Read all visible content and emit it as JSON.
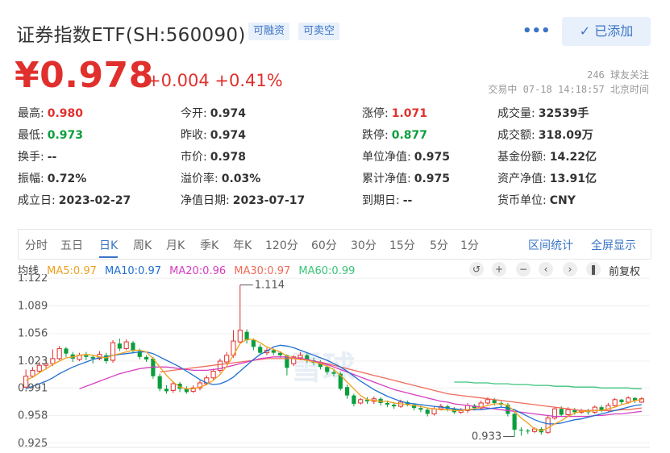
{
  "header": {
    "title": "证券指数ETF(SH:560090)",
    "tag1": "可融资",
    "tag2": "可卖空",
    "more": "•••",
    "added_label": "已添加"
  },
  "quote": {
    "price": "¥0.978",
    "change": "+0.004  +0.41%",
    "followers": "246 球友关注",
    "status": "交易中 07-18 14:18:57 北京时间"
  },
  "stats": [
    {
      "label": "最高:",
      "value": "0.980",
      "color": "red"
    },
    {
      "label": "今开:",
      "value": "0.974",
      "color": ""
    },
    {
      "label": "涨停:",
      "value": "1.071",
      "color": "red"
    },
    {
      "label": "成交量:",
      "value": "32539手",
      "color": ""
    },
    {
      "label": "最低:",
      "value": "0.973",
      "color": "green"
    },
    {
      "label": "昨收:",
      "value": "0.974",
      "color": ""
    },
    {
      "label": "跌停:",
      "value": "0.877",
      "color": "green"
    },
    {
      "label": "成交额:",
      "value": "318.09万",
      "color": ""
    },
    {
      "label": "换手:",
      "value": "--",
      "color": ""
    },
    {
      "label": "市价:",
      "value": "0.978",
      "color": ""
    },
    {
      "label": "单位净值:",
      "value": "0.975",
      "color": ""
    },
    {
      "label": "基金份额:",
      "value": "14.22亿",
      "color": ""
    },
    {
      "label": "振幅:",
      "value": "0.72%",
      "color": ""
    },
    {
      "label": "溢价率:",
      "value": "0.03%",
      "color": ""
    },
    {
      "label": "累计净值:",
      "value": "0.975",
      "color": ""
    },
    {
      "label": "资产净值:",
      "value": "13.91亿",
      "color": ""
    },
    {
      "label": "成立日:",
      "value": "2023-02-27",
      "color": ""
    },
    {
      "label": "净值日期:",
      "value": "2023-07-17",
      "color": ""
    },
    {
      "label": "到期日:",
      "value": "--",
      "color": ""
    },
    {
      "label": "货币单位:",
      "value": "CNY",
      "color": ""
    }
  ],
  "tabs": [
    "分时",
    "五日",
    "日K",
    "周K",
    "月K",
    "季K",
    "年K",
    "120分",
    "60分",
    "30分",
    "15分",
    "5分",
    "1分"
  ],
  "active_tab": 2,
  "tab_links": {
    "interval": "区间统计",
    "fullscreen": "全屏显示"
  },
  "ma": {
    "label": "均线",
    "ma5": "MA5:0.97",
    "ma10": "MA10:0.97",
    "ma20": "MA20:0.96",
    "ma30": "MA30:0.97",
    "ma60": "MA60:0.99"
  },
  "controls": {
    "reset": "↺",
    "zoom_in": "+",
    "zoom_out": "−",
    "prev": "‹",
    "next": "›",
    "pause": "❚",
    "adjust": "前复权"
  },
  "watermark": "雪球",
  "colors": {
    "up": "#e0302d",
    "down": "#0a9e3c",
    "ma5": "#f0a01e",
    "ma10": "#1f6fd1",
    "ma20": "#d63cc2",
    "ma30": "#f06b5a",
    "ma60": "#3cc47a"
  },
  "chart_data": {
    "type": "candlestick",
    "y_ticks": [
      "1.122",
      "1.089",
      "1.056",
      "1.023",
      "0.991",
      "0.958",
      "0.925"
    ],
    "ylim": [
      0.92,
      1.127
    ],
    "annotations": {
      "high": "1.114",
      "low": "0.933"
    },
    "candles": [
      [
        1.005,
        0.992,
        1.013,
        0.99
      ],
      [
        1.012,
        1.005,
        1.016,
        1.003
      ],
      [
        1.018,
        1.011,
        1.022,
        1.009
      ],
      [
        1.02,
        1.018,
        1.026,
        1.013
      ],
      [
        1.026,
        1.02,
        1.037,
        1.017
      ],
      [
        1.038,
        1.026,
        1.041,
        1.024
      ],
      [
        1.032,
        1.038,
        1.04,
        1.028
      ],
      [
        1.026,
        1.031,
        1.034,
        1.022
      ],
      [
        1.03,
        1.025,
        1.033,
        1.023
      ],
      [
        1.028,
        1.03,
        1.034,
        1.024
      ],
      [
        1.026,
        1.028,
        1.03,
        1.02
      ],
      [
        1.031,
        1.026,
        1.035,
        1.024
      ],
      [
        1.023,
        1.03,
        1.033,
        1.02
      ],
      [
        1.045,
        1.024,
        1.048,
        1.021
      ],
      [
        1.038,
        1.044,
        1.05,
        1.035
      ],
      [
        1.046,
        1.038,
        1.049,
        1.036
      ],
      [
        1.035,
        1.045,
        1.047,
        1.032
      ],
      [
        1.028,
        1.035,
        1.038,
        1.025
      ],
      [
        1.025,
        1.028,
        1.03,
        1.022
      ],
      [
        1.005,
        1.026,
        1.028,
        1.002
      ],
      [
        0.99,
        1.005,
        1.008,
        0.987
      ],
      [
        0.987,
        0.99,
        0.994,
        0.984
      ],
      [
        0.996,
        0.988,
        0.999,
        0.985
      ],
      [
        0.99,
        0.996,
        0.998,
        0.986
      ],
      [
        0.986,
        0.99,
        0.993,
        0.984
      ],
      [
        0.991,
        0.987,
        0.994,
        0.985
      ],
      [
        0.997,
        0.991,
        1.0,
        0.988
      ],
      [
        1.003,
        0.996,
        1.006,
        0.994
      ],
      [
        1.011,
        1.003,
        1.014,
        1.001
      ],
      [
        1.023,
        1.012,
        1.026,
        1.009
      ],
      [
        1.03,
        1.022,
        1.034,
        1.019
      ],
      [
        1.047,
        1.03,
        1.06,
        1.027
      ],
      [
        1.06,
        1.046,
        1.114,
        1.044
      ],
      [
        1.048,
        1.058,
        1.061,
        1.044
      ],
      [
        1.04,
        1.048,
        1.05,
        1.036
      ],
      [
        1.033,
        1.04,
        1.043,
        1.03
      ],
      [
        1.036,
        1.033,
        1.039,
        1.03
      ],
      [
        1.033,
        1.036,
        1.038,
        1.03
      ],
      [
        1.03,
        1.033,
        1.035,
        1.027
      ],
      [
        1.015,
        1.03,
        1.031,
        1.006
      ],
      [
        1.028,
        1.02,
        1.03,
        1.017
      ],
      [
        1.03,
        1.027,
        1.034,
        1.024
      ],
      [
        1.024,
        1.03,
        1.032,
        1.021
      ],
      [
        1.021,
        1.024,
        1.027,
        1.018
      ],
      [
        1.016,
        1.021,
        1.024,
        1.013
      ],
      [
        1.01,
        1.016,
        1.018,
        1.007
      ],
      [
        1.008,
        1.01,
        1.014,
        1.005
      ],
      [
        0.99,
        1.008,
        1.01,
        0.988
      ],
      [
        0.982,
        0.992,
        0.995,
        0.978
      ],
      [
        0.972,
        0.982,
        0.984,
        0.969
      ],
      [
        0.977,
        0.973,
        0.979,
        0.971
      ],
      [
        0.975,
        0.977,
        0.98,
        0.972
      ],
      [
        0.978,
        0.975,
        0.981,
        0.972
      ],
      [
        0.973,
        0.978,
        0.98,
        0.97
      ],
      [
        0.971,
        0.973,
        0.976,
        0.968
      ],
      [
        0.969,
        0.971,
        0.974,
        0.966
      ],
      [
        0.974,
        0.969,
        0.977,
        0.967
      ],
      [
        0.971,
        0.974,
        0.976,
        0.969
      ],
      [
        0.967,
        0.971,
        0.973,
        0.964
      ],
      [
        0.965,
        0.967,
        0.97,
        0.962
      ],
      [
        0.96,
        0.965,
        0.967,
        0.957
      ],
      [
        0.966,
        0.96,
        0.969,
        0.958
      ],
      [
        0.969,
        0.966,
        0.972,
        0.964
      ],
      [
        0.966,
        0.969,
        0.971,
        0.963
      ],
      [
        0.962,
        0.966,
        0.968,
        0.96
      ],
      [
        0.964,
        0.962,
        0.967,
        0.96
      ],
      [
        0.97,
        0.964,
        0.973,
        0.961
      ],
      [
        0.967,
        0.97,
        0.972,
        0.964
      ],
      [
        0.973,
        0.967,
        0.976,
        0.965
      ],
      [
        0.977,
        0.973,
        0.98,
        0.971
      ],
      [
        0.973,
        0.977,
        0.979,
        0.97
      ],
      [
        0.971,
        0.973,
        0.975,
        0.968
      ],
      [
        0.96,
        0.971,
        0.973,
        0.957
      ],
      [
        0.941,
        0.96,
        0.962,
        0.933
      ],
      [
        0.94,
        0.941,
        0.944,
        0.934
      ],
      [
        0.939,
        0.94,
        0.942,
        0.936
      ],
      [
        0.942,
        0.939,
        0.944,
        0.937
      ],
      [
        0.938,
        0.942,
        0.944,
        0.935
      ],
      [
        0.955,
        0.938,
        0.958,
        0.936
      ],
      [
        0.966,
        0.955,
        0.968,
        0.953
      ],
      [
        0.959,
        0.966,
        0.969,
        0.957
      ],
      [
        0.965,
        0.959,
        0.968,
        0.957
      ],
      [
        0.962,
        0.965,
        0.967,
        0.959
      ],
      [
        0.964,
        0.962,
        0.966,
        0.96
      ],
      [
        0.962,
        0.964,
        0.966,
        0.959
      ],
      [
        0.968,
        0.962,
        0.97,
        0.96
      ],
      [
        0.964,
        0.968,
        0.97,
        0.962
      ],
      [
        0.97,
        0.964,
        0.973,
        0.962
      ],
      [
        0.977,
        0.97,
        0.979,
        0.968
      ],
      [
        0.974,
        0.977,
        0.978,
        0.971
      ],
      [
        0.979,
        0.974,
        0.981,
        0.972
      ],
      [
        0.976,
        0.979,
        0.98,
        0.973
      ],
      [
        0.978,
        0.974,
        0.98,
        0.973
      ]
    ],
    "ma_lines": {
      "ma5": [
        1.0,
        1.004,
        1.009,
        1.014,
        1.019,
        1.023,
        1.027,
        1.028,
        1.03,
        1.031,
        1.03,
        1.028,
        1.027,
        1.03,
        1.032,
        1.034,
        1.036,
        1.036,
        1.034,
        1.026,
        1.016,
        1.006,
        0.998,
        0.992,
        0.99,
        0.99,
        0.992,
        0.995,
        1.0,
        1.007,
        1.017,
        1.03,
        1.044,
        1.049,
        1.049,
        1.045,
        1.04,
        1.037,
        1.034,
        1.029,
        1.026,
        1.025,
        1.024,
        1.022,
        1.02,
        1.017,
        1.013,
        1.006,
        0.998,
        0.99,
        0.982,
        0.977,
        0.976,
        0.975,
        0.975,
        0.973,
        0.972,
        0.971,
        0.97,
        0.969,
        0.967,
        0.966,
        0.965,
        0.965,
        0.964,
        0.964,
        0.965,
        0.966,
        0.968,
        0.97,
        0.972,
        0.972,
        0.97,
        0.963,
        0.955,
        0.949,
        0.942,
        0.94,
        0.943,
        0.948,
        0.952,
        0.957,
        0.961,
        0.963,
        0.963,
        0.964,
        0.964,
        0.966,
        0.968,
        0.971,
        0.973,
        0.976,
        0.977
      ],
      "ma10": [
        0.99,
        0.993,
        0.996,
        0.999,
        1.003,
        1.008,
        1.012,
        1.016,
        1.019,
        1.022,
        1.025,
        1.027,
        1.028,
        1.03,
        1.031,
        1.032,
        1.033,
        1.034,
        1.034,
        1.032,
        1.028,
        1.024,
        1.02,
        1.016,
        1.011,
        1.006,
        1.001,
        0.997,
        0.995,
        0.996,
        0.999,
        1.004,
        1.011,
        1.018,
        1.025,
        1.031,
        1.035,
        1.04,
        1.042,
        1.041,
        1.039,
        1.036,
        1.033,
        1.03,
        1.027,
        1.024,
        1.02,
        1.016,
        1.011,
        1.005,
        0.999,
        0.994,
        0.989,
        0.985,
        0.981,
        0.978,
        0.975,
        0.973,
        0.972,
        0.971,
        0.97,
        0.969,
        0.968,
        0.967,
        0.966,
        0.965,
        0.965,
        0.965,
        0.965,
        0.966,
        0.967,
        0.968,
        0.967,
        0.965,
        0.961,
        0.957,
        0.953,
        0.95,
        0.948,
        0.948,
        0.949,
        0.951,
        0.953,
        0.954,
        0.956,
        0.958,
        0.96,
        0.962,
        0.964,
        0.966,
        0.968,
        0.97,
        0.971
      ],
      "ma20": [
        null,
        null,
        null,
        null,
        null,
        null,
        null,
        null,
        0.99,
        0.993,
        0.996,
        0.999,
        1.002,
        1.005,
        1.008,
        1.01,
        1.012,
        1.014,
        1.015,
        1.016,
        1.016,
        1.016,
        1.015,
        1.014,
        1.013,
        1.012,
        1.012,
        1.012,
        1.013,
        1.014,
        1.016,
        1.018,
        1.02,
        1.022,
        1.024,
        1.026,
        1.027,
        1.028,
        1.028,
        1.028,
        1.027,
        1.026,
        1.025,
        1.023,
        1.021,
        1.019,
        1.016,
        1.013,
        1.01,
        1.007,
        1.004,
        1.001,
        0.998,
        0.995,
        0.992,
        0.989,
        0.987,
        0.985,
        0.983,
        0.981,
        0.979,
        0.977,
        0.975,
        0.974,
        0.972,
        0.971,
        0.97,
        0.969,
        0.968,
        0.967,
        0.966,
        0.965,
        0.964,
        0.963,
        0.962,
        0.961,
        0.96,
        0.959,
        0.958,
        0.957,
        0.957,
        0.957,
        0.957,
        0.957,
        0.957,
        0.958,
        0.958,
        0.959,
        0.96,
        0.96,
        0.961,
        0.962,
        0.963
      ],
      "ma30": [
        null,
        null,
        null,
        null,
        null,
        null,
        null,
        null,
        null,
        null,
        null,
        null,
        null,
        null,
        null,
        null,
        null,
        null,
        null,
        null,
        1.01,
        1.011,
        1.012,
        1.013,
        1.014,
        1.015,
        1.016,
        1.017,
        1.018,
        1.019,
        1.02,
        1.021,
        1.022,
        1.023,
        1.024,
        1.025,
        1.026,
        1.026,
        1.026,
        1.026,
        1.026,
        1.025,
        1.024,
        1.023,
        1.022,
        1.02,
        1.018,
        1.016,
        1.014,
        1.012,
        1.01,
        1.008,
        1.006,
        1.004,
        1.002,
        1.0,
        0.998,
        0.996,
        0.994,
        0.992,
        0.99,
        0.988,
        0.986,
        0.984,
        0.983,
        0.982,
        0.981,
        0.98,
        0.979,
        0.978,
        0.977,
        0.976,
        0.975,
        0.974,
        0.973,
        0.972,
        0.971,
        0.97,
        0.969,
        0.968,
        0.967,
        0.966,
        0.965,
        0.964,
        0.964,
        0.964,
        0.964,
        0.964,
        0.964,
        0.965,
        0.965,
        0.966,
        0.967
      ],
      "ma60": [
        null,
        null,
        null,
        null,
        null,
        null,
        null,
        null,
        null,
        null,
        null,
        null,
        null,
        null,
        null,
        null,
        null,
        null,
        null,
        null,
        null,
        null,
        null,
        null,
        null,
        null,
        null,
        null,
        null,
        null,
        null,
        null,
        null,
        null,
        null,
        null,
        null,
        null,
        null,
        null,
        null,
        null,
        null,
        null,
        null,
        null,
        null,
        null,
        null,
        null,
        null,
        null,
        null,
        null,
        null,
        null,
        null,
        null,
        null,
        null,
        null,
        null,
        null,
        null,
        0.998,
        0.998,
        0.998,
        0.997,
        0.997,
        0.997,
        0.996,
        0.996,
        0.996,
        0.995,
        0.995,
        0.995,
        0.994,
        0.994,
        0.994,
        0.993,
        0.993,
        0.993,
        0.992,
        0.992,
        0.992,
        0.992,
        0.991,
        0.991,
        0.991,
        0.991,
        0.991,
        0.99,
        0.99
      ]
    }
  }
}
